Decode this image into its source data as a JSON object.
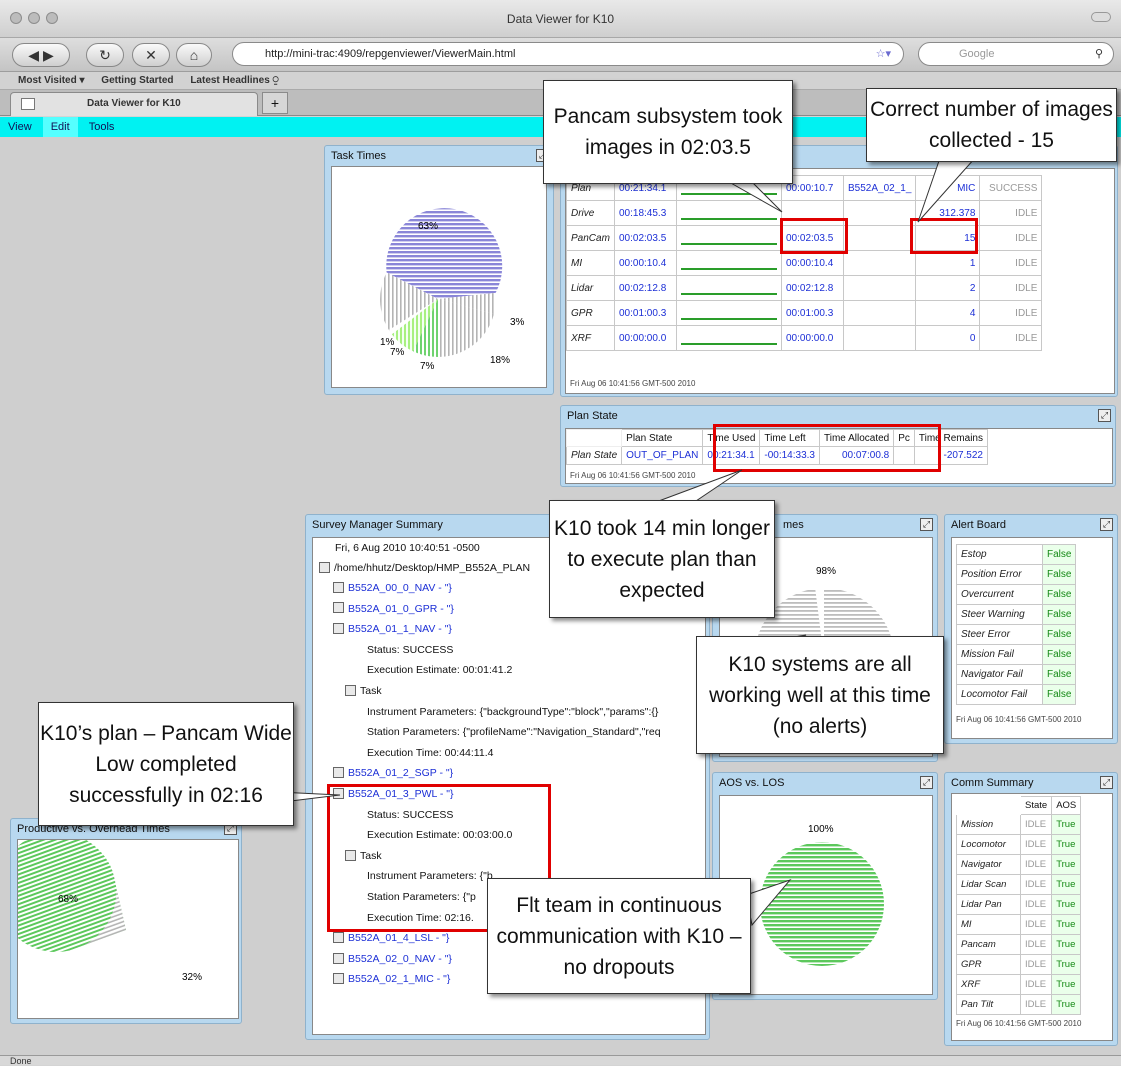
{
  "window": {
    "title": "Data Viewer for K10"
  },
  "nav": {
    "url": "http://mini-trac:4909/repgenviewer/ViewerMain.html",
    "search_placeholder": "Google"
  },
  "bookmarks": [
    "Most Visited ▾",
    "Getting Started",
    "Latest Headlines ⍜"
  ],
  "tab": {
    "label": "Data Viewer for K10",
    "new_tab": "+"
  },
  "app_menu": [
    "View",
    "Edit",
    "Tools"
  ],
  "task_times": {
    "title": "Task Times",
    "labels": [
      "63%",
      "3%",
      "1%",
      "7%",
      "7%",
      "18%"
    ]
  },
  "tasks_table": {
    "rows": [
      {
        "name": "Plan",
        "time": "00:21:34.1",
        "used": "00:00:10.7",
        "task": "B552A_02_1_",
        "images": "MIC",
        "state": "SUCCESS"
      },
      {
        "name": "Drive",
        "time": "00:18:45.3",
        "used": "",
        "task": "",
        "images": "312.378",
        "state": "IDLE"
      },
      {
        "name": "PanCam",
        "time": "00:02:03.5",
        "used": "00:02:03.5",
        "task": "",
        "images": "15",
        "state": "IDLE"
      },
      {
        "name": "MI",
        "time": "00:00:10.4",
        "used": "00:00:10.4",
        "task": "",
        "images": "1",
        "state": "IDLE"
      },
      {
        "name": "Lidar",
        "time": "00:02:12.8",
        "used": "00:02:12.8",
        "task": "",
        "images": "2",
        "state": "IDLE"
      },
      {
        "name": "GPR",
        "time": "00:01:00.3",
        "used": "00:01:00.3",
        "task": "",
        "images": "4",
        "state": "IDLE"
      },
      {
        "name": "XRF",
        "time": "00:00:00.0",
        "used": "00:00:00.0",
        "task": "",
        "images": "0",
        "state": "IDLE"
      }
    ],
    "timestamp": "Fri Aug 06 10:41:56 GMT-500 2010"
  },
  "plan_state": {
    "title": "Plan State",
    "headers": [
      "Plan State",
      "Time Used",
      "Time Left",
      "Time Allocated",
      "Pc",
      "Time Remains"
    ],
    "row_label": "Plan State",
    "values": [
      "OUT_OF_PLAN",
      "00:21:34.1",
      "-00:14:33.3",
      "00:07:00.8",
      "",
      "-207.522"
    ],
    "timestamp": "Fri Aug 06 10:41:56 GMT-500 2010"
  },
  "survey": {
    "title": "Survey Manager Summary",
    "date": "Fri, 6 Aug 2010 10:40:51 -0500",
    "path": "/home/hhutz/Desktop/HMP_B552A_PLAN",
    "items": [
      "B552A_00_0_NAV - \"}",
      "B552A_01_0_GPR - \"}",
      "B552A_01_1_NAV - \"}",
      "Status: SUCCESS",
      "Execution Estimate: 00:01:41.2",
      "Task",
      "Instrument Parameters: {\"backgroundType\":\"block\",\"params\":{}",
      "Station Parameters: {\"profileName\":\"Navigation_Standard\",\"req",
      "Execution Time: 00:44:11.4",
      "B552A_01_2_SGP - \"}",
      "B552A_01_3_PWL - \"}",
      "Status: SUCCESS",
      "Execution Estimate: 00:03:00.0",
      "Task",
      "Instrument Parameters: {\"b",
      "Station Parameters: {\"p",
      "Execution Time: 02:16.",
      "B552A_01_4_LSL - \"}",
      "B552A_02_0_NAV - \"}",
      "B552A_02_1_MIC - \"}"
    ]
  },
  "mid_pie": {
    "title": "mes",
    "label": "98%"
  },
  "alert_board": {
    "title": "Alert Board",
    "items": [
      {
        "name": "Estop",
        "value": "False"
      },
      {
        "name": "Position Error",
        "value": "False"
      },
      {
        "name": "Overcurrent",
        "value": "False"
      },
      {
        "name": "Steer Warning",
        "value": "False"
      },
      {
        "name": "Steer Error",
        "value": "False"
      },
      {
        "name": "Mission Fail",
        "value": "False"
      },
      {
        "name": "Navigator Fail",
        "value": "False"
      },
      {
        "name": "Locomotor Fail",
        "value": "False"
      }
    ],
    "timestamp": "Fri Aug 06 10:41:56 GMT-500 2010"
  },
  "aos": {
    "title": "AOS vs. LOS",
    "label": "100%"
  },
  "comm": {
    "title": "Comm Summary",
    "headers": [
      "State",
      "AOS"
    ],
    "items": [
      {
        "name": "Mission",
        "state": "IDLE",
        "aos": "True"
      },
      {
        "name": "Locomotor",
        "state": "IDLE",
        "aos": "True"
      },
      {
        "name": "Navigator",
        "state": "IDLE",
        "aos": "True"
      },
      {
        "name": "Lidar Scan",
        "state": "IDLE",
        "aos": "True"
      },
      {
        "name": "Lidar Pan",
        "state": "IDLE",
        "aos": "True"
      },
      {
        "name": "MI",
        "state": "IDLE",
        "aos": "True"
      },
      {
        "name": "Pancam",
        "state": "IDLE",
        "aos": "True"
      },
      {
        "name": "GPR",
        "state": "IDLE",
        "aos": "True"
      },
      {
        "name": "XRF",
        "state": "IDLE",
        "aos": "True"
      },
      {
        "name": "Pan Tilt",
        "state": "IDLE",
        "aos": "True"
      }
    ],
    "timestamp": "Fri Aug 06 10:41:56 GMT-500 2010"
  },
  "productive": {
    "title": "Productive vs. Overhead Times",
    "labels": [
      "68%",
      "32%"
    ]
  },
  "callouts": {
    "pancam": "Pancam subsystem took images in 02:03.5",
    "images": "Correct number of images collected - 15",
    "plan": "K10 took 14 min longer to execute plan than expected",
    "systems": "K10 systems are all working well at this time (no alerts)",
    "pwl": "K10’s plan – Pancam Wide Low completed successfully in 02:16",
    "comm": "Flt team in continuous communication with K10 – no dropouts"
  },
  "status": "Done",
  "colors": {
    "menu": "#00f2f2",
    "panel": "#b8d8ef",
    "highlight": "#e00000"
  }
}
